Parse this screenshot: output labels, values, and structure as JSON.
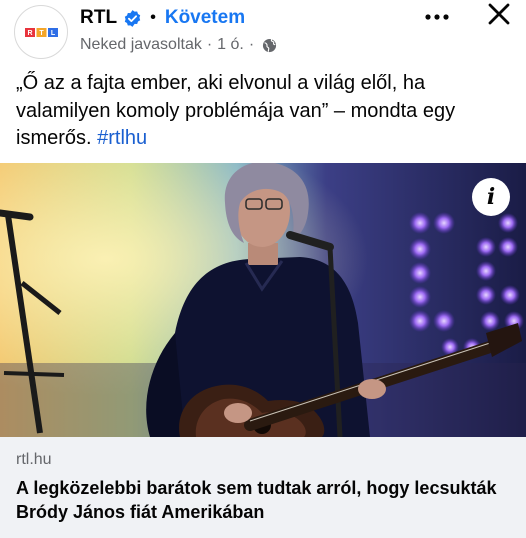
{
  "post": {
    "page_name": "RTL",
    "avatar_logo_text": "RTL",
    "dot": "•",
    "follow_label": "Követem",
    "meta": {
      "context": "Neked javasoltak",
      "separator": "·",
      "time": "1 ó.",
      "audience_icon": "globe-icon"
    },
    "icons": {
      "verified": "verified-badge-icon",
      "more": "more-options-icon",
      "close": "close-icon",
      "info": "info-icon"
    },
    "more_glyph": "•••",
    "info_glyph": "i",
    "text": "„Ő az a fajta ember, aki elvonul a világ elől, ha valamilyen komoly problémája van” – mondta egy ismerős.",
    "hashtag": "#rtlhu",
    "link": {
      "domain": "rtl.hu",
      "title": "A legközelebbi barátok sem tudtak arról, hogy lecsukták Bródy János fiát Amerikában"
    }
  },
  "colors": {
    "brand_blue": "#1877f2",
    "hashtag_blue": "#1a5fd0",
    "secondary_text": "#65676b",
    "card_background": "#f0f2f5",
    "rtl_red": "#e8343d",
    "rtl_orange": "#f4a62a",
    "rtl_blue": "#2f6ee6"
  }
}
